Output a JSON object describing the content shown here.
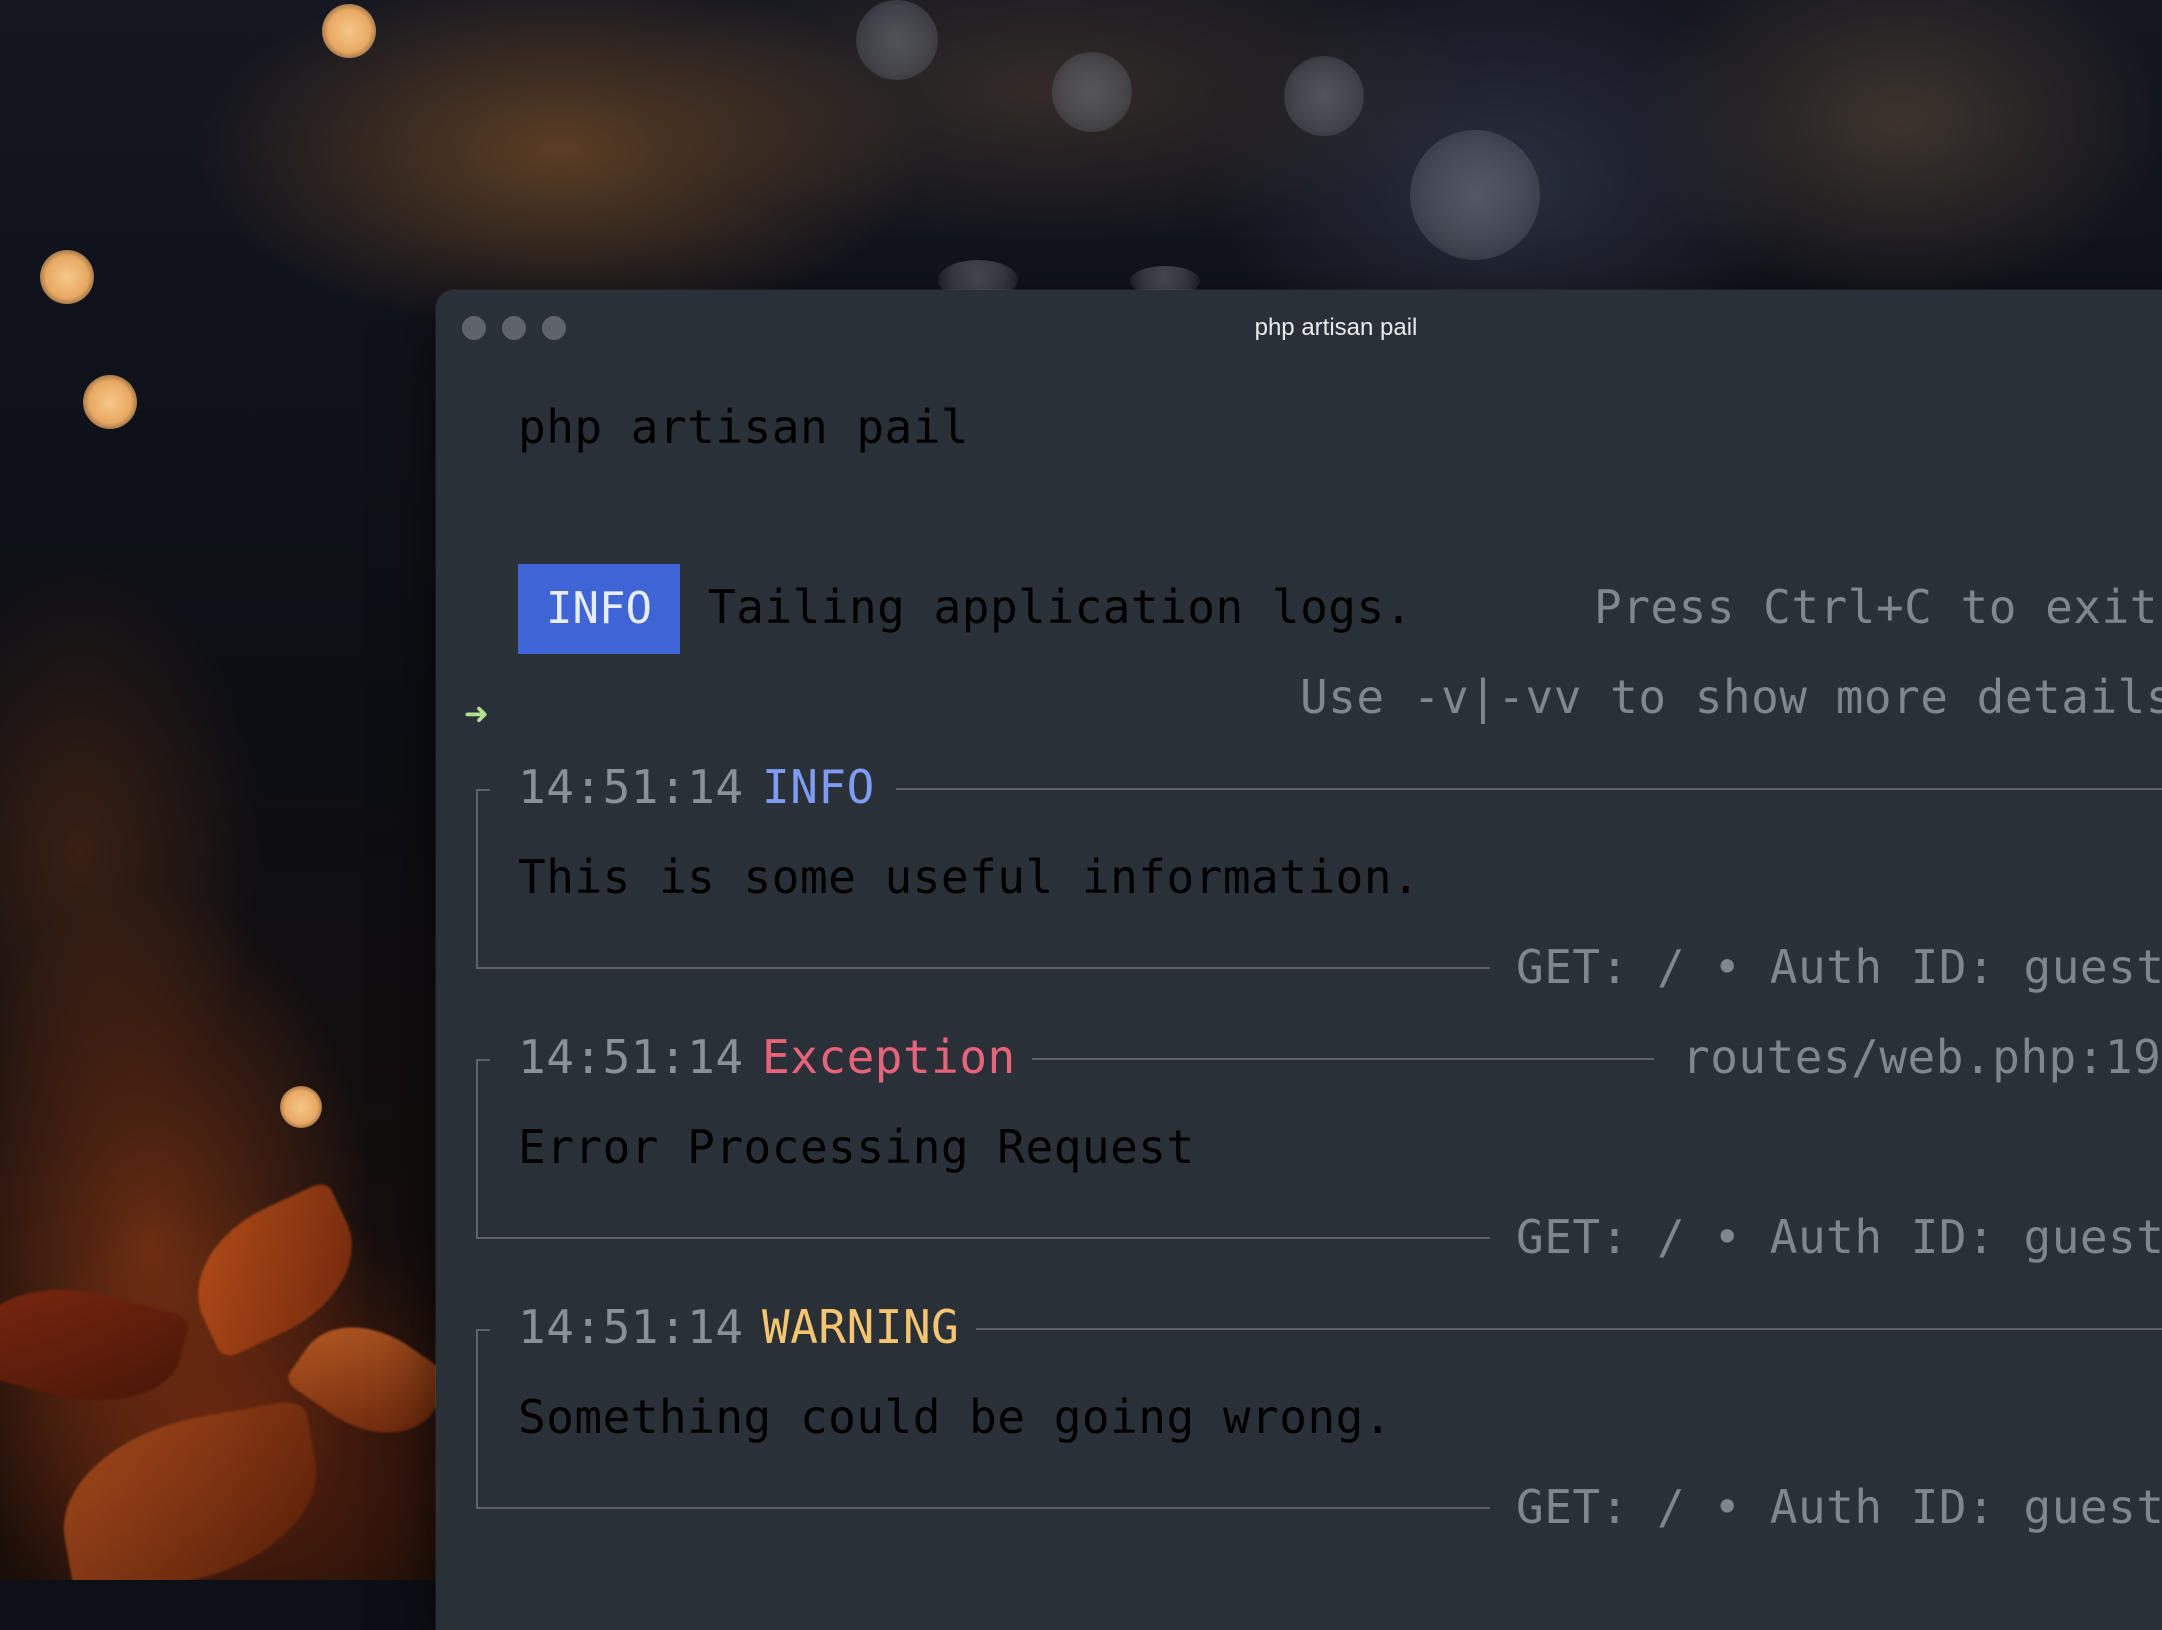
{
  "window": {
    "title": "php artisan pail",
    "traffic_lights": [
      "close",
      "minimize",
      "zoom"
    ]
  },
  "prompt": {
    "arrow": "➜",
    "command": "php artisan pail"
  },
  "banner": {
    "badge": "INFO",
    "message": "Tailing application logs.",
    "hint_exit": "Press Ctrl+C to exit",
    "hint_verbose": "Use -v|-vv to show more details"
  },
  "entries": [
    {
      "time": "14:51:14",
      "level": "INFO",
      "level_color": "#7f9cf5",
      "location": "",
      "message": "This is some useful information.",
      "footer": "GET: / • Auth ID: guest"
    },
    {
      "time": "14:51:14",
      "level": "Exception",
      "level_color": "#e8627a",
      "location": "routes/web.php:19",
      "message": "Error Processing Request",
      "footer": "GET: / • Auth ID: guest"
    },
    {
      "time": "14:51:14",
      "level": "WARNING",
      "level_color": "#f5c56f",
      "location": "",
      "message": "Something could be going wrong.",
      "footer": "GET: / • Auth ID: guest"
    }
  ],
  "colors": {
    "window_bg": "#2a3037",
    "badge_bg": "#3f64d6",
    "prompt_arrow": "#b3e090"
  }
}
